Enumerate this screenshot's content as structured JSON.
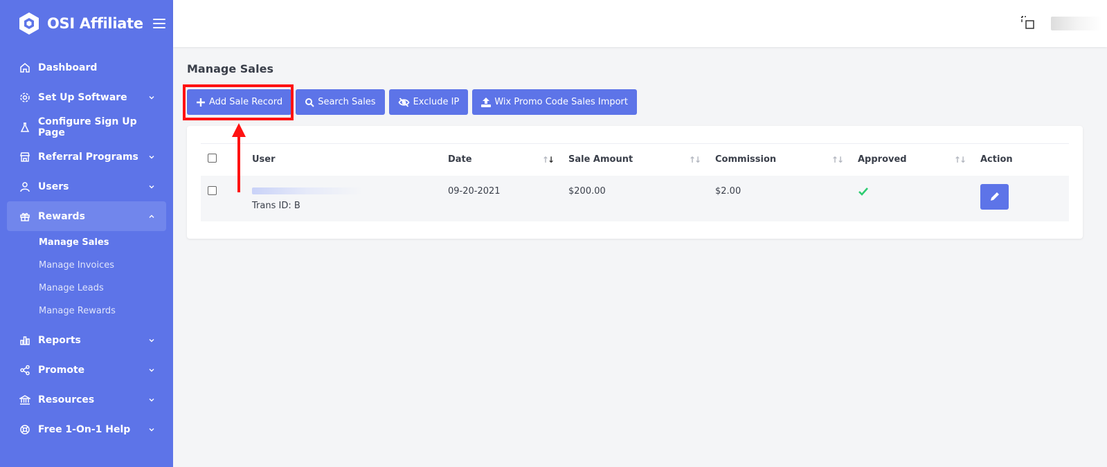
{
  "app": {
    "name": "OSI Affiliate"
  },
  "sidebar": {
    "items": [
      {
        "label": "Dashboard",
        "icon": "home-icon",
        "has_children": false
      },
      {
        "label": "Set Up Software",
        "icon": "gear-icon",
        "has_children": true
      },
      {
        "label": "Configure Sign Up Page",
        "icon": "flask-icon",
        "has_children": false
      },
      {
        "label": "Referral Programs",
        "icon": "store-icon",
        "has_children": true
      },
      {
        "label": "Users",
        "icon": "user-icon",
        "has_children": true
      },
      {
        "label": "Rewards",
        "icon": "gift-icon",
        "has_children": true,
        "expanded": true
      },
      {
        "label": "Reports",
        "icon": "bar-chart-icon",
        "has_children": true
      },
      {
        "label": "Promote",
        "icon": "share-icon",
        "has_children": true
      },
      {
        "label": "Resources",
        "icon": "bank-icon",
        "has_children": true
      },
      {
        "label": "Free 1-On-1 Help",
        "icon": "lifebuoy-icon",
        "has_children": true
      }
    ],
    "rewards_sub": [
      "Manage Sales",
      "Manage Invoices",
      "Manage Leads",
      "Manage Rewards"
    ],
    "current_sub": "Manage Sales"
  },
  "page": {
    "title": "Manage Sales",
    "buttons": {
      "add": "Add Sale Record",
      "search": "Search Sales",
      "exclude": "Exclude IP",
      "wix": "Wix Promo Code Sales Import"
    }
  },
  "table": {
    "columns": [
      "User",
      "Date",
      "Sale Amount",
      "Commission",
      "Approved",
      "Action"
    ],
    "rows": [
      {
        "trans_id": "Trans ID: B",
        "date": "09-20-2021",
        "sale_amount": "$200.00",
        "commission": "$2.00",
        "approved": true
      }
    ]
  },
  "colors": {
    "accent": "#5d74e8",
    "highlight": "#ff1212",
    "approved": "#2ecc71"
  }
}
